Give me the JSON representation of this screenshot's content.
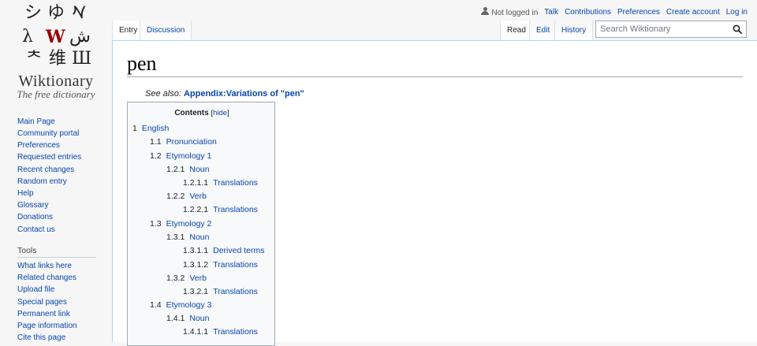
{
  "logo": {
    "glyphs": [
      "シ",
      "ゆ",
      "𐡀",
      "ጰ",
      "λ",
      "W",
      "ش",
      "ᄎ",
      "维",
      "Ш"
    ],
    "title": "Wiktionary",
    "tagline": "The free dictionary"
  },
  "sidebar": {
    "nav": [
      "Main Page",
      "Community portal",
      "Preferences",
      "Requested entries",
      "Recent changes",
      "Random entry",
      "Help",
      "Glossary",
      "Donations",
      "Contact us"
    ],
    "tools_heading": "Tools",
    "tools": [
      "What links here",
      "Related changes",
      "Upload file",
      "Special pages",
      "Permanent link",
      "Page information",
      "Cite this page"
    ]
  },
  "personal": {
    "not_logged_in": "Not logged in",
    "links": [
      "Talk",
      "Contributions",
      "Preferences",
      "Create account",
      "Log in"
    ]
  },
  "tabs": {
    "entry": "Entry",
    "discussion": "Discussion",
    "read": "Read",
    "edit": "Edit",
    "history": "History"
  },
  "search": {
    "placeholder": "Search Wiktionary"
  },
  "page": {
    "title": "pen",
    "see_also_label": "See also:",
    "see_also_link": "Appendix:Variations of \"pen\""
  },
  "toc": {
    "title": "Contents",
    "bracket_open": "[",
    "hide": "hide",
    "bracket_close": "]",
    "items": [
      {
        "num": "1",
        "text": "English",
        "level": 1
      },
      {
        "num": "1.1",
        "text": "Pronunciation",
        "level": 2
      },
      {
        "num": "1.2",
        "text": "Etymology 1",
        "level": 2
      },
      {
        "num": "1.2.1",
        "text": "Noun",
        "level": 3
      },
      {
        "num": "1.2.1.1",
        "text": "Translations",
        "level": 4
      },
      {
        "num": "1.2.2",
        "text": "Verb",
        "level": 3
      },
      {
        "num": "1.2.2.1",
        "text": "Translations",
        "level": 4
      },
      {
        "num": "1.3",
        "text": "Etymology 2",
        "level": 2
      },
      {
        "num": "1.3.1",
        "text": "Noun",
        "level": 3
      },
      {
        "num": "1.3.1.1",
        "text": "Derived terms",
        "level": 4
      },
      {
        "num": "1.3.1.2",
        "text": "Translations",
        "level": 4
      },
      {
        "num": "1.3.2",
        "text": "Verb",
        "level": 3
      },
      {
        "num": "1.3.2.1",
        "text": "Translations",
        "level": 4
      },
      {
        "num": "1.4",
        "text": "Etymology 3",
        "level": 2
      },
      {
        "num": "1.4.1",
        "text": "Noun",
        "level": 3
      },
      {
        "num": "1.4.1.1",
        "text": "Translations",
        "level": 4
      }
    ]
  },
  "colors": {
    "link": "#0645ad",
    "logo_glyph": "#1a1a1a",
    "logo_accent": "#990000",
    "border": "#a7d7f9",
    "background": "#f6f6f6"
  }
}
